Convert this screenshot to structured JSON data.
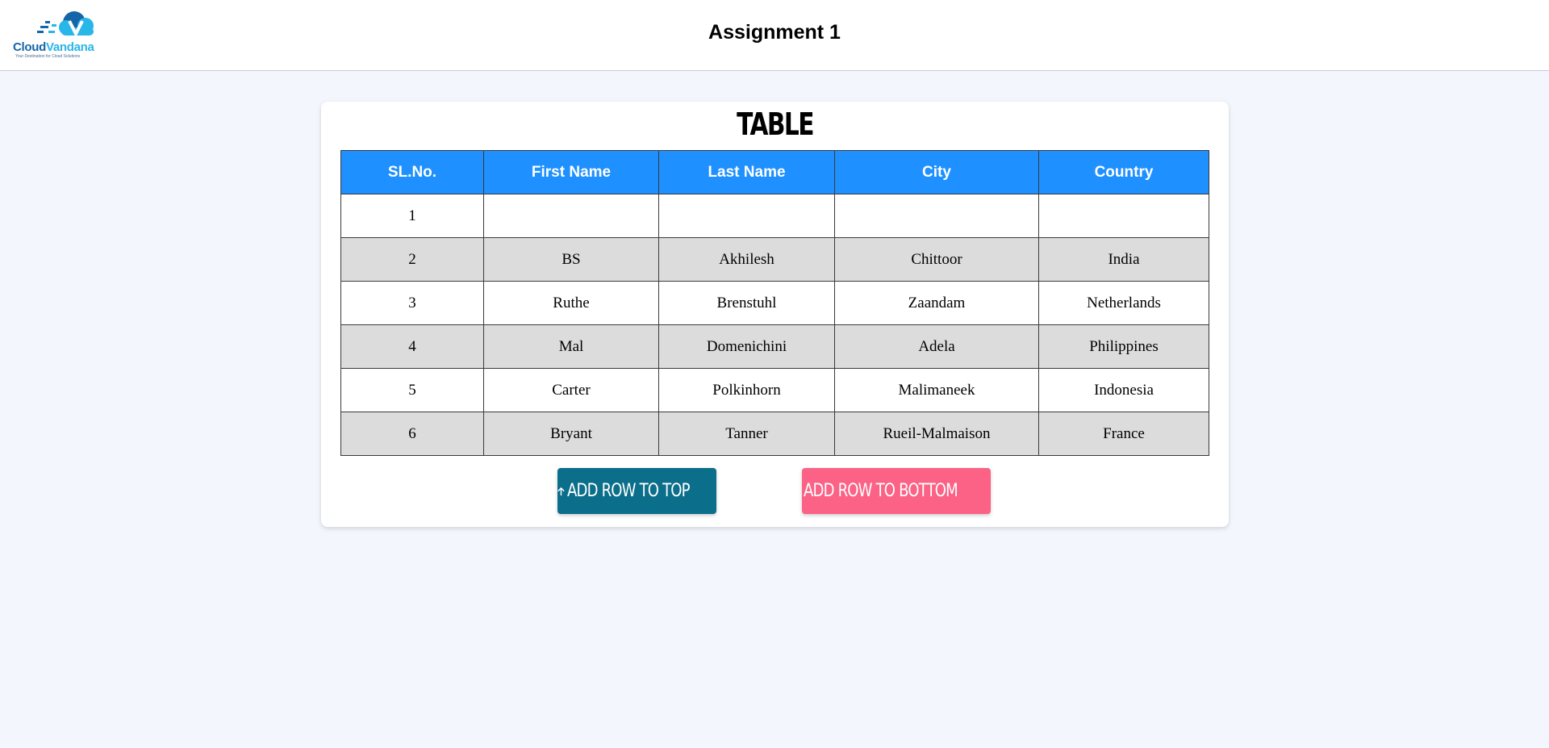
{
  "header": {
    "logo": {
      "brand_primary": "Cloud",
      "brand_secondary": "Vandana",
      "tagline": "Your Destination for Cloud Solutions",
      "icon": "cloud-logo-icon"
    },
    "title": "Assignment 1"
  },
  "main": {
    "card_title": "TABLE",
    "table": {
      "columns": [
        "SL.No.",
        "First Name",
        "Last Name",
        "City",
        "Country"
      ],
      "rows": [
        [
          "1",
          "",
          "",
          "",
          ""
        ],
        [
          "2",
          "BS",
          "Akhilesh",
          "Chittoor",
          "India"
        ],
        [
          "3",
          "Ruthe",
          "Brenstuhl",
          "Zaandam",
          "Netherlands"
        ],
        [
          "4",
          "Mal",
          "Domenichini",
          "Adela",
          "Philippines"
        ],
        [
          "5",
          "Carter",
          "Polkinhorn",
          "Malimaneek",
          "Indonesia"
        ],
        [
          "6",
          "Bryant",
          "Tanner",
          "Rueil-Malmaison",
          "France"
        ]
      ]
    },
    "buttons": {
      "add_top": {
        "label": "ADD ROW TO TOP",
        "icon": "arrow-up-icon",
        "color": "#0b6e8a"
      },
      "add_bottom": {
        "label": "ADD ROW TO BOTTOM",
        "icon": "arrow-down-icon",
        "color": "#fb6286"
      }
    }
  },
  "colors": {
    "page_background": "#f3f7fd",
    "table_header": "#1e90ff",
    "row_alt": "#dcdcdc"
  }
}
